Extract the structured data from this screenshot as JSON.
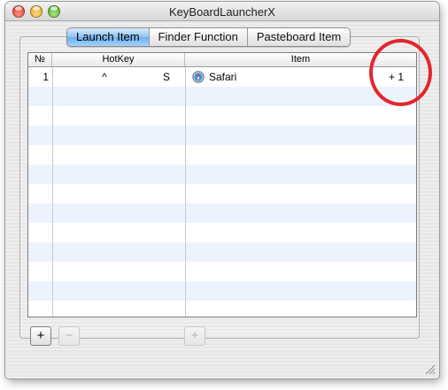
{
  "window": {
    "title": "KeyBoardLauncherX"
  },
  "tabs": [
    {
      "label": "Launch Item",
      "active": true
    },
    {
      "label": "Finder Function",
      "active": false
    },
    {
      "label": "Pasteboard Item",
      "active": false
    }
  ],
  "table": {
    "columns": [
      "№",
      "HotKey",
      "Item"
    ],
    "rows": [
      {
        "number": "1",
        "modifier": "^",
        "key": "S",
        "item": "Safari",
        "item_icon": "safari-compass-icon",
        "extra": "+ 1"
      }
    ]
  },
  "buttons": {
    "add": "+",
    "remove": "−",
    "add_item": "+"
  },
  "colors": {
    "highlight_ring": "#e3262d",
    "row_stripe": "#edf3fe",
    "tab_active": "#6eaef0"
  }
}
